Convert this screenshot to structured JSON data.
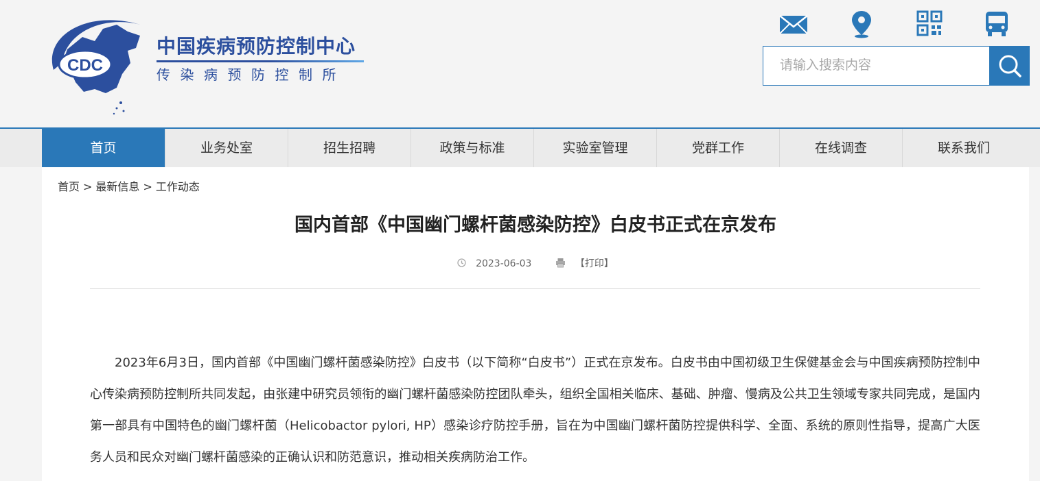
{
  "header": {
    "logo_text": "CDC",
    "org_name": "中国疾病预防控制中心",
    "org_subtitle": "传染病预防控制所",
    "icons": [
      "mail-icon",
      "location-icon",
      "qrcode-icon",
      "bus-icon"
    ],
    "search": {
      "placeholder": "请输入搜索内容",
      "value": ""
    }
  },
  "nav": {
    "items": [
      {
        "label": "首页",
        "active": true
      },
      {
        "label": "业务处室"
      },
      {
        "label": "招生招聘"
      },
      {
        "label": "政策与标准"
      },
      {
        "label": "实验室管理"
      },
      {
        "label": "党群工作"
      },
      {
        "label": "在线调查"
      },
      {
        "label": "联系我们"
      }
    ]
  },
  "breadcrumb": {
    "items": [
      "首页",
      "最新信息",
      "工作动态"
    ],
    "separator": ">"
  },
  "article": {
    "title": "国内首部《中国幽门螺杆菌感染防控》白皮书正式在京发布",
    "date": "2023-06-03",
    "print_label": "【打印】",
    "body": "2023年6月3日，国内首部《中国幽门螺杆菌感染防控》白皮书（以下简称“白皮书”）正式在京发布。白皮书由中国初级卫生保健基金会与中国疾病预防控制中心传染病预防控制所共同发起，由张建中研究员领衔的幽门螺杆菌感染防控团队牵头，组织全国相关临床、基础、肿瘤、慢病及公共卫生领域专家共同完成，是国内第一部具有中国特色的幽门螺杆菌（Helicobactor pylori, HP）感染诊疗防控手册，旨在为中国幽门螺杆菌防控提供科学、全面、系统的原则性指导，提高广大医务人员和民众对幽门螺杆菌感染的正确认识和防范意识，推动相关疾病防治工作。"
  },
  "colors": {
    "brand_blue": "#2a78b8",
    "logo_blue": "#2c4f9e",
    "nav_bg": "#ebebeb",
    "page_bg": "#f4f4f4"
  }
}
